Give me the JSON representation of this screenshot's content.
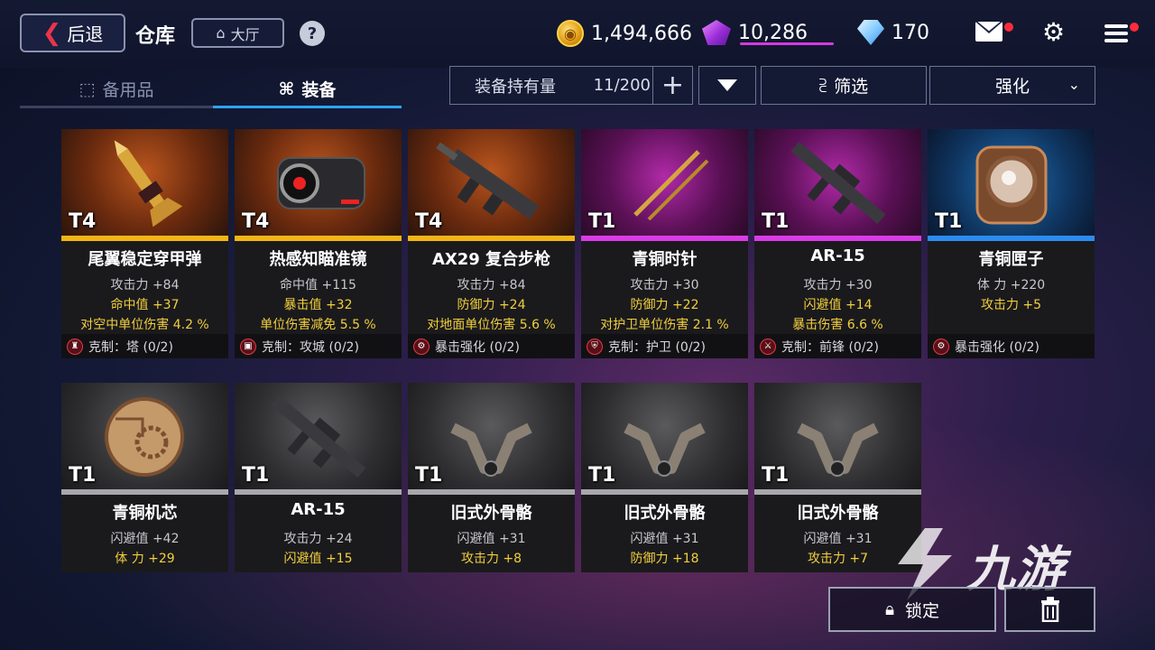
{
  "header": {
    "back_label": "后退",
    "title": "仓库",
    "lobby_label": "大厅",
    "help_symbol": "?",
    "gold": "1,494,666",
    "gems": "10,286",
    "diamonds": "170"
  },
  "tabs": [
    {
      "label": "备用品",
      "icon": "box-icon",
      "active": false
    },
    {
      "label": "装备",
      "icon": "gun-icon",
      "active": true
    }
  ],
  "toolbar": {
    "count_label": "装备持有量",
    "count_value": "11/200",
    "plus_symbol": "+",
    "filter_label": "筛选",
    "enhance_label": "强化"
  },
  "items": [
    {
      "tier": "T4",
      "rarity": "orange",
      "name": "尾翼稳定穿甲弹",
      "stat1": "攻击力 +84",
      "stat2": "命中值 +37",
      "stat3": "对空中单位伤害 4.2 %",
      "skill": "克制：塔 (0/2)"
    },
    {
      "tier": "T4",
      "rarity": "orange",
      "name": "热感知瞄准镜",
      "stat1": "命中值 +115",
      "stat2": "暴击值 +32",
      "stat3": "单位伤害减免 5.5 %",
      "skill": "克制：攻城 (0/2)"
    },
    {
      "tier": "T4",
      "rarity": "orange",
      "name": "AX29 复合步枪",
      "stat1": "攻击力 +84",
      "stat2": "防御力 +24",
      "stat3": "对地面单位伤害 5.6 %",
      "skill": "暴击强化 (0/2)"
    },
    {
      "tier": "T1",
      "rarity": "purple",
      "name": "青铜时针",
      "stat1": "攻击力 +30",
      "stat2": "防御力 +22",
      "stat3": "对护卫单位伤害 2.1 %",
      "skill": "克制：护卫 (0/2)"
    },
    {
      "tier": "T1",
      "rarity": "purple",
      "name": "AR-15",
      "stat1": "攻击力 +30",
      "stat2": "闪避值 +14",
      "stat3": "暴击伤害 6.6 %",
      "skill": "克制：前锋 (0/2)"
    },
    {
      "tier": "T1",
      "rarity": "blue",
      "name": "青铜匣子",
      "stat1": "体 力 +220",
      "stat2": "攻击力 +5",
      "stat3": "",
      "skill": "暴击强化 (0/2)"
    },
    {
      "tier": "T1",
      "rarity": "gray",
      "name": "青铜机芯",
      "stat1": "闪避值 +42",
      "stat2": "体 力 +29"
    },
    {
      "tier": "T1",
      "rarity": "gray",
      "name": "AR-15",
      "stat1": "攻击力 +24",
      "stat2": "闪避值 +15"
    },
    {
      "tier": "T1",
      "rarity": "gray",
      "name": "旧式外骨骼",
      "stat1": "闪避值 +31",
      "stat2": "攻击力 +8"
    },
    {
      "tier": "T1",
      "rarity": "gray",
      "name": "旧式外骨骼",
      "stat1": "闪避值 +31",
      "stat2": "防御力 +18"
    },
    {
      "tier": "T1",
      "rarity": "gray",
      "name": "旧式外骨骼",
      "stat1": "闪避值 +31",
      "stat2": "攻击力 +7"
    }
  ],
  "footer": {
    "lock_label": "锁定"
  },
  "watermark": {
    "text": "九游"
  }
}
